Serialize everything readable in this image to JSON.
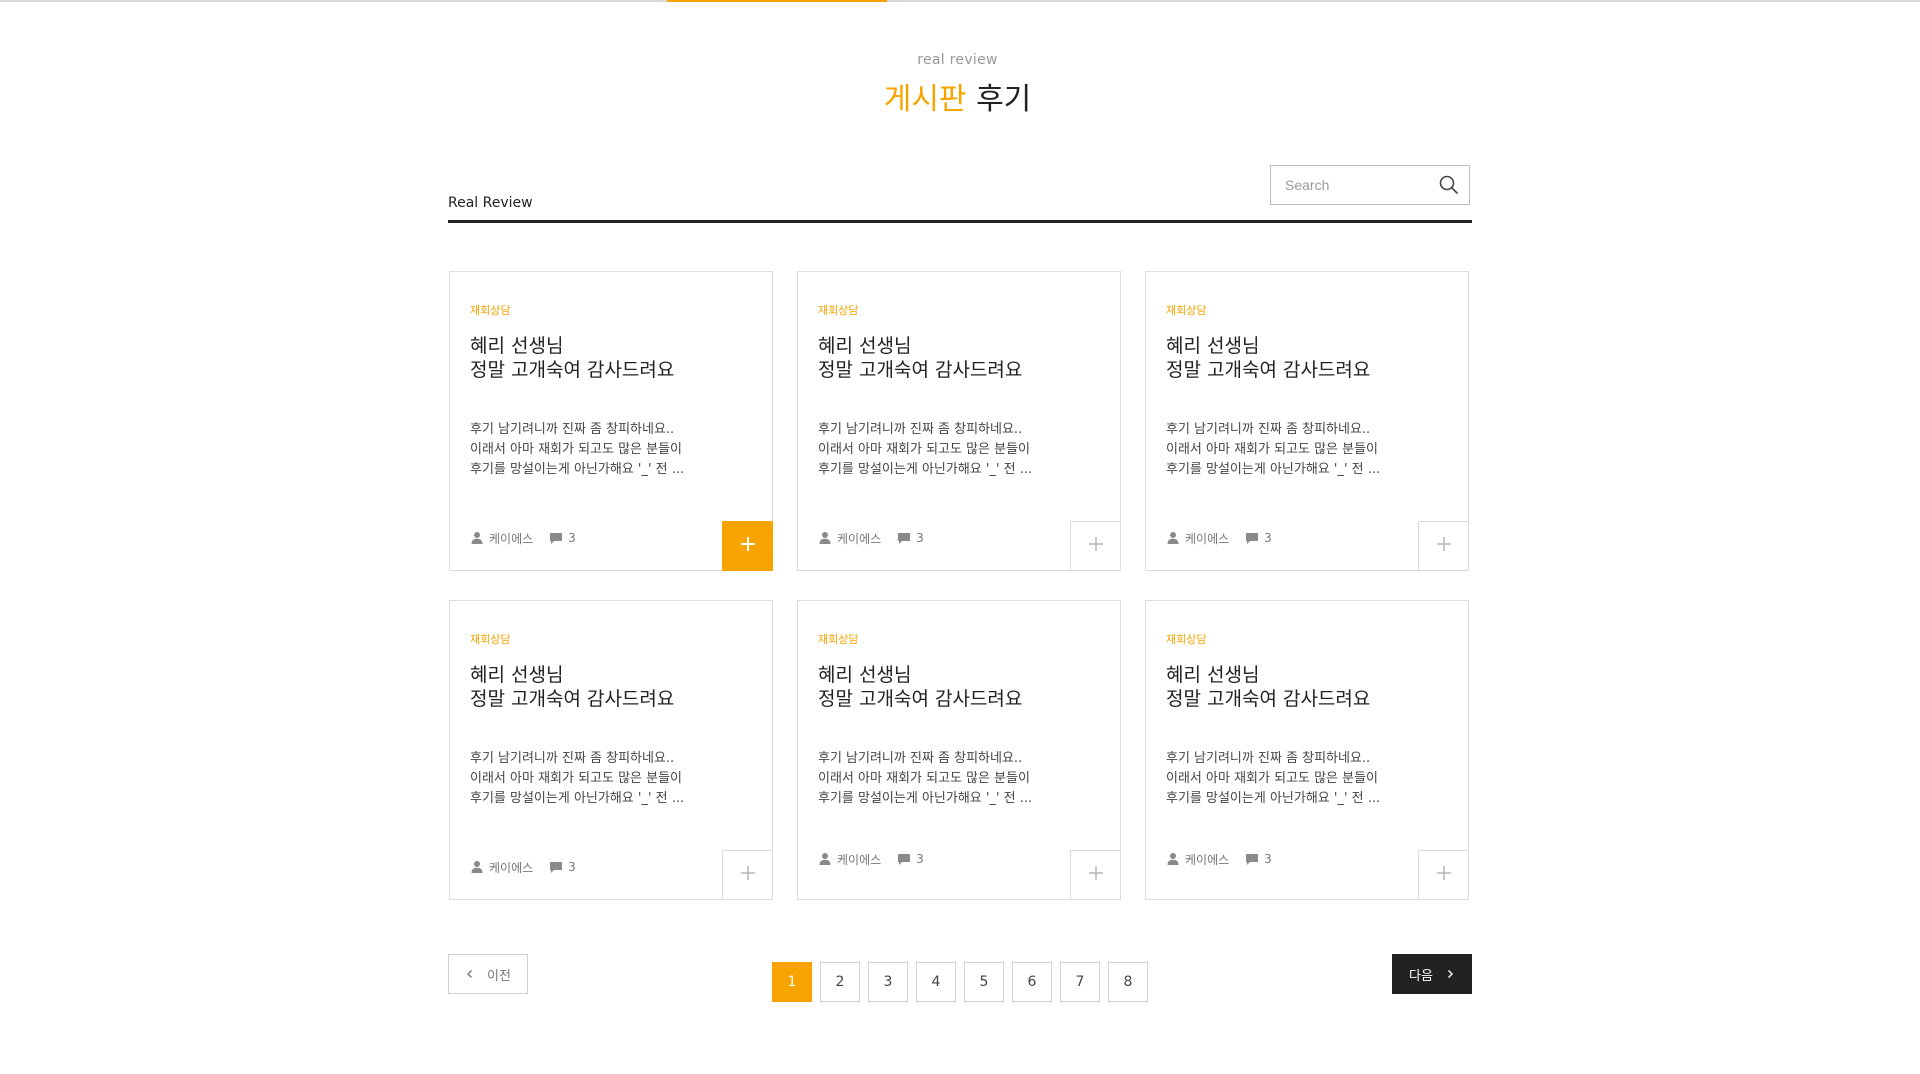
{
  "header": {
    "eyebrow": "real review",
    "title_accent": "게시판",
    "title_rest": " 후기"
  },
  "board": {
    "label": "Real Review",
    "search_placeholder": "Search"
  },
  "cards": [
    {
      "category": "재회상담",
      "title": "혜리 선생님\n정말 고개숙여 감사드려요",
      "excerpt": "후기 남기려니까 진짜 좀 창피하네요..\n이래서 아마 재회가 되고도 많은 분들이\n후기를 망설이는게 아닌가해요 '_' 전 ...",
      "author": "케이에스",
      "comments": "3",
      "plus": "+"
    },
    {
      "category": "재회상담",
      "title": "혜리 선생님\n정말 고개숙여 감사드려요",
      "excerpt": "후기 남기려니까 진짜 좀 창피하네요..\n이래서 아마 재회가 되고도 많은 분들이\n후기를 망설이는게 아닌가해요 '_' 전 ...",
      "author": "케이에스",
      "comments": "3",
      "plus": "+"
    },
    {
      "category": "재회상담",
      "title": "혜리 선생님\n정말 고개숙여 감사드려요",
      "excerpt": "후기 남기려니까 진짜 좀 창피하네요..\n이래서 아마 재회가 되고도 많은 분들이\n후기를 망설이는게 아닌가해요 '_' 전 ...",
      "author": "케이에스",
      "comments": "3",
      "plus": "+"
    },
    {
      "category": "재회상담",
      "title": "혜리 선생님\n정말 고개숙여 감사드려요",
      "excerpt": "후기 남기려니까 진짜 좀 창피하네요..\n이래서 아마 재회가 되고도 많은 분들이\n후기를 망설이는게 아닌가해요 '_' 전 ...",
      "author": "케이에스",
      "comments": "3",
      "plus": "+"
    },
    {
      "category": "재회상담",
      "title": "혜리 선생님\n정말 고개숙여 감사드려요",
      "excerpt": "후기 남기려니까 진짜 좀 창피하네요..\n이래서 아마 재회가 되고도 많은 분들이\n후기를 망설이는게 아닌가해요 '_' 전 ...",
      "author": "케이에스",
      "comments": "3",
      "plus": "+"
    },
    {
      "category": "재회상담",
      "title": "혜리 선생님\n정말 고개숙여 감사드려요",
      "excerpt": "후기 남기려니까 진짜 좀 창피하네요..\n이래서 아마 재회가 되고도 많은 분들이\n후기를 망설이는게 아닌가해요 '_' 전 ...",
      "author": "케이에스",
      "comments": "3",
      "plus": "+"
    }
  ],
  "pagination": {
    "prev_label": "이전",
    "next_label": "다음",
    "pages": [
      "1",
      "2",
      "3",
      "4",
      "5",
      "6",
      "7",
      "8"
    ],
    "current": "1"
  },
  "colors": {
    "accent": "#f7a400",
    "dark": "#222222",
    "border": "#dcdcdc"
  },
  "icons": {
    "search": "search-icon",
    "author": "user-icon",
    "comments": "comment-icon",
    "more": "plus-icon",
    "prev": "chevron-left-icon",
    "next": "chevron-right-icon"
  }
}
